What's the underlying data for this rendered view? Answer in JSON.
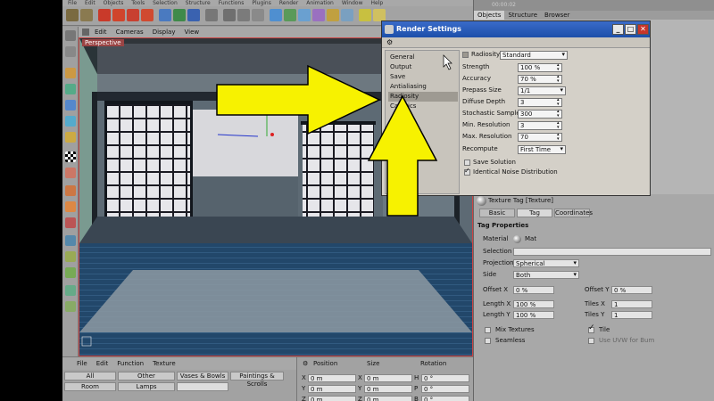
{
  "menubar": {
    "items": [
      "File",
      "Edit",
      "Objects",
      "Tools",
      "Selection",
      "Structure",
      "Functions",
      "Plugins",
      "Render",
      "Animation",
      "Window",
      "Help"
    ]
  },
  "viewport": {
    "menu": [
      "Edit",
      "Cameras",
      "Display",
      "View"
    ],
    "label": "Perspective"
  },
  "right_panel": {
    "time": "00:00:02",
    "tabs": [
      "Objects",
      "Structure",
      "Browser"
    ],
    "texture_tag": {
      "title": "Texture Tag [Texture]",
      "tabs": [
        "Basic",
        "Tag",
        "Coordinates"
      ],
      "section": "Tag Properties",
      "material_label": "Material",
      "material_value": "Mat",
      "selection_label": "Selection",
      "projection_label": "Projection",
      "projection_value": "Spherical",
      "side_label": "Side",
      "side_value": "Both",
      "offset_x_label": "Offset X",
      "offset_x_value": "0 %",
      "offset_y_label": "Offset Y",
      "offset_y_value": "0 %",
      "length_x_label": "Length X",
      "length_x_value": "100 %",
      "length_y_label": "Length Y",
      "length_y_value": "100 %",
      "tiles_x_label": "Tiles X",
      "tiles_x_value": "1",
      "tiles_y_label": "Tiles Y",
      "tiles_y_value": "1",
      "mix_textures": "Mix Textures",
      "tile": "Tile",
      "seamless": "Seamless",
      "use_uvw": "Use UVW for Bum"
    }
  },
  "materials": {
    "menu": [
      "File",
      "Edit",
      "Function",
      "Texture"
    ],
    "cells": [
      "All",
      "Other",
      "Vases & Bowls",
      "Paintings & Scrolls",
      "Room",
      "Lamps"
    ]
  },
  "coordinates": {
    "headers": [
      "Position",
      "Size",
      "Rotation"
    ],
    "rows": [
      {
        "axis": "X",
        "pos": "0 m",
        "size": "0 m",
        "rot_axis": "H",
        "rot": "0 °"
      },
      {
        "axis": "Y",
        "pos": "0 m",
        "size": "0 m",
        "rot_axis": "P",
        "rot": "0 °"
      },
      {
        "axis": "Z",
        "pos": "0 m",
        "size": "0 m",
        "rot_axis": "B",
        "rot": "0 °"
      }
    ]
  },
  "dialog": {
    "title": "Render Settings",
    "nav": [
      "General",
      "Output",
      "Save",
      "Antialiasing",
      "Radiosity",
      "Caustics"
    ],
    "nav_partial": "VR",
    "radiosity_label": "Radiosity",
    "radiosity_mode": "Standard",
    "strength_label": "Strength",
    "strength_value": "100 %",
    "accuracy_label": "Accuracy",
    "accuracy_value": "70 %",
    "prepass_label": "Prepass Size",
    "prepass_value": "1/1",
    "diffuse_label": "Diffuse Depth",
    "diffuse_value": "3",
    "stochastic_label": "Stochastic Samples",
    "stochastic_value": "300",
    "minres_label": "Min. Resolution",
    "minres_value": "3",
    "maxres_label": "Max. Resolution",
    "maxres_value": "70",
    "recompute_label": "Recompute",
    "recompute_value": "First Time",
    "save_solution": "Save Solution",
    "identical_noise": "Identical Noise Distribution",
    "win_minimize": "_",
    "win_maximize": "□",
    "win_close": "✕"
  },
  "colors": {
    "arrow": "#f7f200",
    "title_bar": "#2a5cba"
  }
}
